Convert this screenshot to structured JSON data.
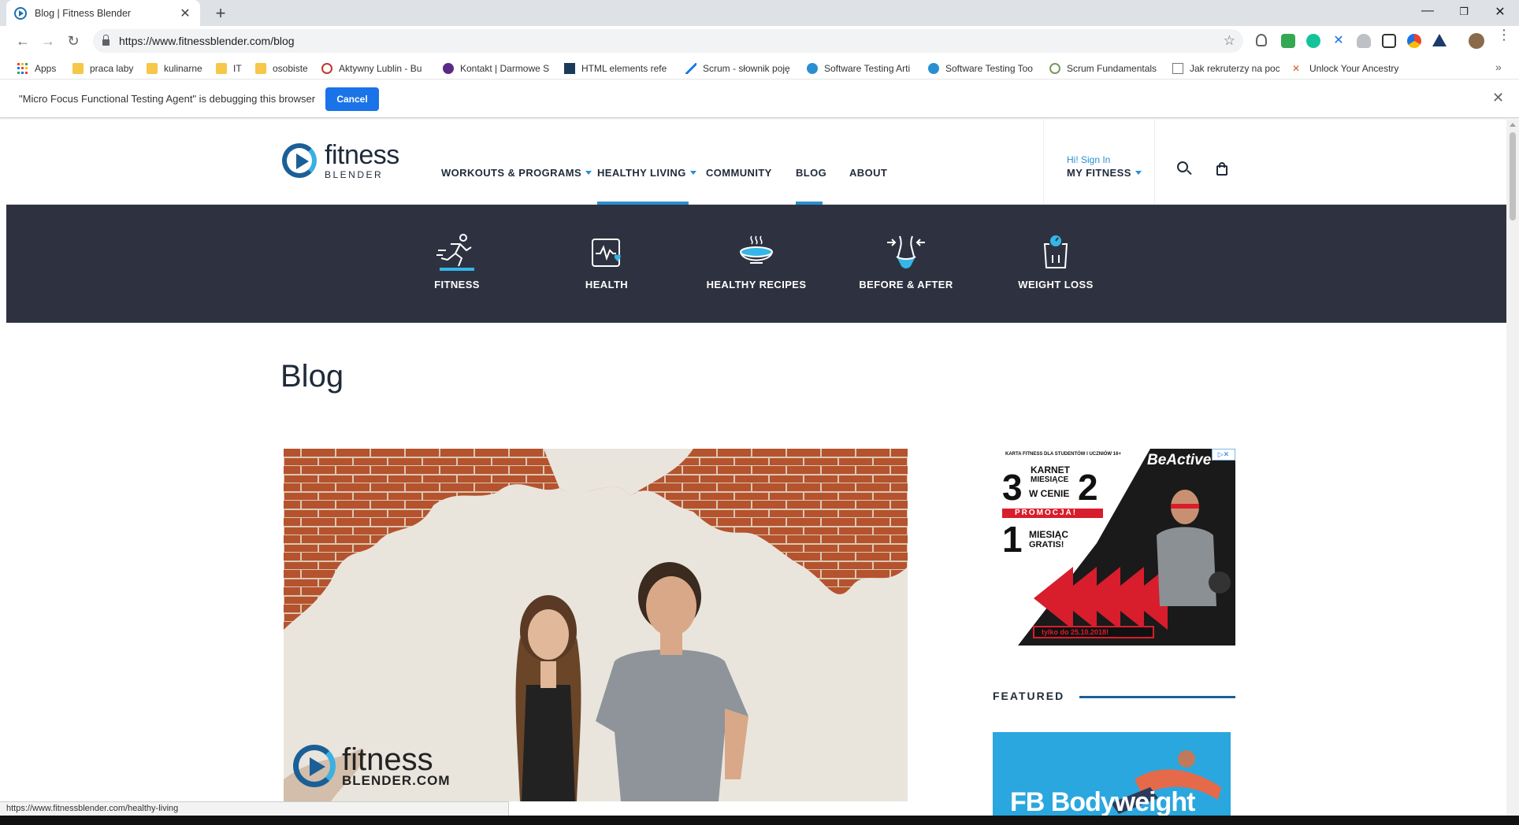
{
  "browser": {
    "tab_title": "Blog | Fitness Blender",
    "tab_close": "✕",
    "new_tab": "+",
    "window_controls": {
      "minimize": "—",
      "maximize": "❐",
      "close": "✕"
    },
    "nav": {
      "back": "←",
      "forward": "→",
      "reload": "↻"
    },
    "url": "https://www.fitnessblender.com/blog",
    "star": "☆",
    "menu": "⋮",
    "bookmarks": [
      {
        "label": "Apps",
        "icon": "apps-grid-icon"
      },
      {
        "label": "praca laby",
        "icon": "folder-icon"
      },
      {
        "label": "kulinarne",
        "icon": "folder-icon"
      },
      {
        "label": "IT",
        "icon": "folder-icon"
      },
      {
        "label": "osobiste",
        "icon": "folder-icon"
      },
      {
        "label": "Aktywny Lublin - Bu",
        "icon": "clock-icon"
      },
      {
        "label": "Kontakt | Darmowe S",
        "icon": "site-icon"
      },
      {
        "label": "HTML elements refe",
        "icon": "site-icon"
      },
      {
        "label": "Scrum - słownik poję",
        "icon": "site-icon"
      },
      {
        "label": "Software Testing Arti",
        "icon": "u-icon"
      },
      {
        "label": "Software Testing Too",
        "icon": "u-icon"
      },
      {
        "label": "Scrum Fundamentals",
        "icon": "site-icon"
      },
      {
        "label": "Jak rekruterzy na poc",
        "icon": "page-icon"
      },
      {
        "label": "Unlock Your Ancestry",
        "icon": "site-icon"
      }
    ],
    "bookmarks_more": "»",
    "infobar": {
      "message": "\"Micro Focus Functional Testing Agent\" is debugging this browser",
      "cancel": "Cancel",
      "close": "✕"
    },
    "status_url": "https://www.fitnessblender.com/healthy-living"
  },
  "site": {
    "logo": {
      "word": "fitness",
      "sub": "BLENDER"
    },
    "nav": [
      {
        "label": "WORKOUTS & PROGRAMS",
        "dropdown": true
      },
      {
        "label": "HEALTHY LIVING",
        "dropdown": true,
        "active": true
      },
      {
        "label": "COMMUNITY",
        "dropdown": false
      },
      {
        "label": "BLOG",
        "dropdown": false,
        "active": true
      },
      {
        "label": "ABOUT",
        "dropdown": false
      }
    ],
    "account": {
      "greeting": "Hi! Sign In",
      "label": "MY FITNESS"
    },
    "categories": [
      {
        "label": "FITNESS",
        "icon": "running-person-icon"
      },
      {
        "label": "HEALTH",
        "icon": "heart-monitor-icon"
      },
      {
        "label": "HEALTHY RECIPES",
        "icon": "bowl-icon"
      },
      {
        "label": "BEFORE & AFTER",
        "icon": "waist-icon"
      },
      {
        "label": "WEIGHT LOSS",
        "icon": "scale-icon"
      }
    ],
    "page_title": "Blog",
    "hero_watermark": {
      "word": "fitness",
      "sub": "BLENDER.COM"
    },
    "ad": {
      "badge": "▷✕",
      "top_line": "KARTA FITNESS DLA STUDENTÓW I UCZNIÓW 16+",
      "brand": "BeActive",
      "big3": "3",
      "big2": "2",
      "line1": "KARNET",
      "line2": "MIESIĄCE",
      "line3": "W CENIE",
      "promo": "PROMOCJA!",
      "big1": "1",
      "line4": "MIESIĄC",
      "line5": "GRATIS!",
      "footer": "tylko do 25.10.2018!"
    },
    "featured": {
      "heading": "FEATURED",
      "card_title": "FB Bodyweight"
    }
  },
  "colors": {
    "accent": "#2a8fd0",
    "navy": "#1f2a3a",
    "category_bar": "#2e3240",
    "chrome_blue": "#1a73e8"
  }
}
